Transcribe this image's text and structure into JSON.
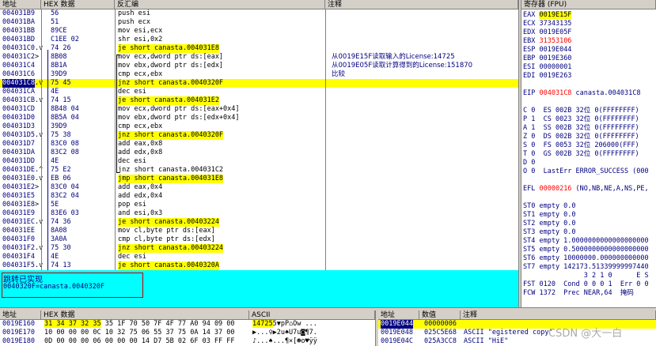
{
  "disasm": {
    "headers": {
      "address": "地址",
      "hex": "HEX 数据",
      "disasm": "反汇编",
      "comment": "注释"
    },
    "rows": [
      {
        "addr": "004031B9",
        "mark": "",
        "hex": "56",
        "dis": "push esi",
        "cmt": "",
        "type": ""
      },
      {
        "addr": "004031BA",
        "mark": "",
        "hex": "51",
        "dis": "push ecx",
        "cmt": "",
        "type": ""
      },
      {
        "addr": "004031BB",
        "mark": "",
        "hex": "89CE",
        "dis": "mov esi,ecx",
        "cmt": "",
        "type": ""
      },
      {
        "addr": "004031BD",
        "mark": "",
        "hex": "C1EE 02",
        "dis": "shr esi,0x2",
        "cmt": "",
        "type": ""
      },
      {
        "addr": "004031C0",
        "mark": ".v",
        "hex": "74 26",
        "dis": "je short canasta.004031E8",
        "cmt": "",
        "type": "jcc"
      },
      {
        "addr": "004031C2",
        "mark": ">",
        "hex": "8B08",
        "dis": "mov ecx,dword ptr ds:[eax]",
        "cmt": "从0019E15F读取输入的License:14725",
        "type": ""
      },
      {
        "addr": "004031C4",
        "mark": "",
        "hex": "8B1A",
        "dis": "mov ebx,dword ptr ds:[edx]",
        "cmt": "从0019E05F读取计算得到的License:151870",
        "type": ""
      },
      {
        "addr": "004031C6",
        "mark": "",
        "hex": "39D9",
        "dis": "cmp ecx,ebx",
        "cmt": "比较",
        "type": ""
      },
      {
        "addr": "004031C8",
        "mark": ".v",
        "hex": "75 45",
        "dis": "jnz short canasta.0040320F",
        "cmt": "",
        "type": "sel"
      },
      {
        "addr": "004031CA",
        "mark": "",
        "hex": "4E",
        "dis": "dec esi",
        "cmt": "",
        "type": ""
      },
      {
        "addr": "004031CB",
        "mark": ".v",
        "hex": "74 15",
        "dis": "je short canasta.004031E2",
        "cmt": "",
        "type": "jcc"
      },
      {
        "addr": "004031CD",
        "mark": "",
        "hex": "8B48 04",
        "dis": "mov ecx,dword ptr ds:[eax+0x4]",
        "cmt": "",
        "type": ""
      },
      {
        "addr": "004031D0",
        "mark": "",
        "hex": "8B5A 04",
        "dis": "mov ebx,dword ptr ds:[edx+0x4]",
        "cmt": "",
        "type": ""
      },
      {
        "addr": "004031D3",
        "mark": "",
        "hex": "39D9",
        "dis": "cmp ecx,ebx",
        "cmt": "",
        "type": ""
      },
      {
        "addr": "004031D5",
        "mark": ".v",
        "hex": "75 38",
        "dis": "jnz short canasta.0040320F",
        "cmt": "",
        "type": "jcc"
      },
      {
        "addr": "004031D7",
        "mark": "",
        "hex": "83C0 08",
        "dis": "add eax,0x8",
        "cmt": "",
        "type": ""
      },
      {
        "addr": "004031DA",
        "mark": "",
        "hex": "83C2 08",
        "dis": "add edx,0x8",
        "cmt": "",
        "type": ""
      },
      {
        "addr": "004031DD",
        "mark": "",
        "hex": "4E",
        "dis": "dec esi",
        "cmt": "",
        "type": ""
      },
      {
        "addr": "004031DE",
        "mark": ".^",
        "hex": "75 E2",
        "dis": "jnz short canasta.004031C2",
        "cmt": "",
        "type": ""
      },
      {
        "addr": "004031E0",
        "mark": ".v",
        "hex": "EB 06",
        "dis": "jmp short canasta.004031E8",
        "cmt": "",
        "type": "jmp"
      },
      {
        "addr": "004031E2",
        "mark": ">",
        "hex": "83C0 04",
        "dis": "add eax,0x4",
        "cmt": "",
        "type": ""
      },
      {
        "addr": "004031E5",
        "mark": "",
        "hex": "83C2 04",
        "dis": "add edx,0x4",
        "cmt": "",
        "type": ""
      },
      {
        "addr": "004031E8",
        "mark": ">",
        "hex": "5E",
        "dis": "pop esi",
        "cmt": "",
        "type": ""
      },
      {
        "addr": "004031E9",
        "mark": "",
        "hex": "83E6 03",
        "dis": "and esi,0x3",
        "cmt": "",
        "type": ""
      },
      {
        "addr": "004031EC",
        "mark": ".v",
        "hex": "74 36",
        "dis": "je short canasta.00403224",
        "cmt": "",
        "type": "jcc"
      },
      {
        "addr": "004031EE",
        "mark": "",
        "hex": "8A08",
        "dis": "mov cl,byte ptr ds:[eax]",
        "cmt": "",
        "type": ""
      },
      {
        "addr": "004031F0",
        "mark": "",
        "hex": "3A0A",
        "dis": "cmp cl,byte ptr ds:[edx]",
        "cmt": "",
        "type": ""
      },
      {
        "addr": "004031F2",
        "mark": ".v",
        "hex": "75 30",
        "dis": "jnz short canasta.00403224",
        "cmt": "",
        "type": "jcc"
      },
      {
        "addr": "004031F4",
        "mark": "",
        "hex": "4E",
        "dis": "dec esi",
        "cmt": "",
        "type": ""
      },
      {
        "addr": "004031F5",
        "mark": ".v",
        "hex": "74 13",
        "dis": "je short canasta.0040320A",
        "cmt": "",
        "type": "jcc"
      }
    ]
  },
  "info": {
    "line1": "跳转已实现",
    "line2": "0040320F=canasta.0040320F"
  },
  "registers": {
    "header": "寄存器 (FPU)",
    "lines": [
      {
        "n": "EAX",
        "v": "0019E15F",
        "rest": "",
        "style": "hl"
      },
      {
        "n": "ECX",
        "v": "37343135",
        "rest": "",
        "style": ""
      },
      {
        "n": "EDX",
        "v": "0019E05F",
        "rest": "",
        "style": ""
      },
      {
        "n": "EBX",
        "v": "31353106",
        "rest": "",
        "style": "red"
      },
      {
        "n": "ESP",
        "v": "0019E044",
        "rest": "",
        "style": ""
      },
      {
        "n": "EBP",
        "v": "0019E360",
        "rest": "",
        "style": ""
      },
      {
        "n": "ESI",
        "v": "00000001",
        "rest": "",
        "style": ""
      },
      {
        "n": "EDI",
        "v": "0019E263",
        "rest": "",
        "style": ""
      },
      {
        "n": "",
        "v": "",
        "rest": "",
        "style": ""
      },
      {
        "n": "EIP",
        "v": "004031C8",
        "rest": " canasta.004031C8",
        "style": "red"
      },
      {
        "n": "",
        "v": "",
        "rest": "",
        "style": ""
      },
      {
        "n": "C 0",
        "v": "",
        "rest": "  ES 002B 32位 0(FFFFFFFF)",
        "style": "flag"
      },
      {
        "n": "P 1",
        "v": "",
        "rest": "  CS 0023 32位 0(FFFFFFFF)",
        "style": "flag"
      },
      {
        "n": "A 1",
        "v": "",
        "rest": "  SS 002B 32位 0(FFFFFFFF)",
        "style": "flag"
      },
      {
        "n": "Z 0",
        "v": "",
        "rest": "  DS 002B 32位 0(FFFFFFFF)",
        "style": "flag"
      },
      {
        "n": "S 0",
        "v": "",
        "rest": "  FS 0053 32位 206000(FFF)",
        "style": "flag"
      },
      {
        "n": "T 0",
        "v": "",
        "rest": "  GS 002B 32位 0(FFFFFFFF)",
        "style": "flag"
      },
      {
        "n": "D 0",
        "v": "",
        "rest": "",
        "style": "flag"
      },
      {
        "n": "O 0",
        "v": "",
        "rest": "  LastErr ERROR_SUCCESS (000",
        "style": "flag"
      },
      {
        "n": "",
        "v": "",
        "rest": "",
        "style": ""
      },
      {
        "n": "EFL",
        "v": "00000216",
        "rest": " (NO,NB,NE,A,NS,PE,",
        "style": "red"
      },
      {
        "n": "",
        "v": "",
        "rest": "",
        "style": ""
      },
      {
        "n": "ST0",
        "v": "",
        "rest": " empty 0.0",
        "style": ""
      },
      {
        "n": "ST1",
        "v": "",
        "rest": " empty 0.0",
        "style": ""
      },
      {
        "n": "ST2",
        "v": "",
        "rest": " empty 0.0",
        "style": ""
      },
      {
        "n": "ST3",
        "v": "",
        "rest": " empty 0.0",
        "style": ""
      },
      {
        "n": "ST4",
        "v": "",
        "rest": " empty 1.0000000000000000000",
        "style": ""
      },
      {
        "n": "ST5",
        "v": "",
        "rest": " empty 0.5000000000000000000",
        "style": ""
      },
      {
        "n": "ST6",
        "v": "",
        "rest": " empty 10000000.000000000000",
        "style": ""
      },
      {
        "n": "ST7",
        "v": "",
        "rest": " empty 142173.51339999997440",
        "style": ""
      },
      {
        "n": "",
        "v": "",
        "rest": "               3 2 1 0      E S",
        "style": ""
      },
      {
        "n": "FST",
        "v": "",
        "rest": " 0120  Cond 0 0 0 1  Err 0 0",
        "style": ""
      },
      {
        "n": "FCW",
        "v": "",
        "rest": " 1372  Prec NEAR,64  掩码",
        "style": ""
      }
    ]
  },
  "dump": {
    "headers": {
      "address": "地址",
      "hex": "HEX 数据",
      "ascii": "ASCII"
    },
    "rows": [
      {
        "addr": "0019E160",
        "hexsel": "31 34 37 32 35",
        "hex": " 35 1F 70 50 7F 4F 77 A0 94 09 00",
        "asciisel": "14725",
        "ascii": "5▼pP⌂Ow ..."
      },
      {
        "addr": "0019E170",
        "hexsel": "",
        "hex": "10 00 00 00 0C 10 32 75 06 55 37 75 0A 14 37 00",
        "asciisel": "",
        "ascii": "▶...♀▶2u♠U7u◙¶7."
      },
      {
        "addr": "0019E180",
        "hexsel": "",
        "hex": "0D 00 00 00 06 00 00 00 14 D7 5B 02 6F 03 FF FF",
        "asciisel": "",
        "ascii": "♪...♠...¶×[☻o♥ÿÿ"
      }
    ]
  },
  "stack": {
    "headers": {
      "address": "地址",
      "value": "数值",
      "comment": "注释"
    },
    "rows": [
      {
        "addr": "0019E044",
        "val": "00000006",
        "cmt": "",
        "sel": true
      },
      {
        "addr": "0019E048",
        "val": "025C5E68",
        "cmt": "ASCII \"egistered copy\"",
        "sel": false
      },
      {
        "addr": "0019E04C",
        "val": "025A3CC8",
        "cmt": "ASCII \"HiE\"",
        "sel": false
      }
    ]
  },
  "watermark": "CSDN @大一白"
}
